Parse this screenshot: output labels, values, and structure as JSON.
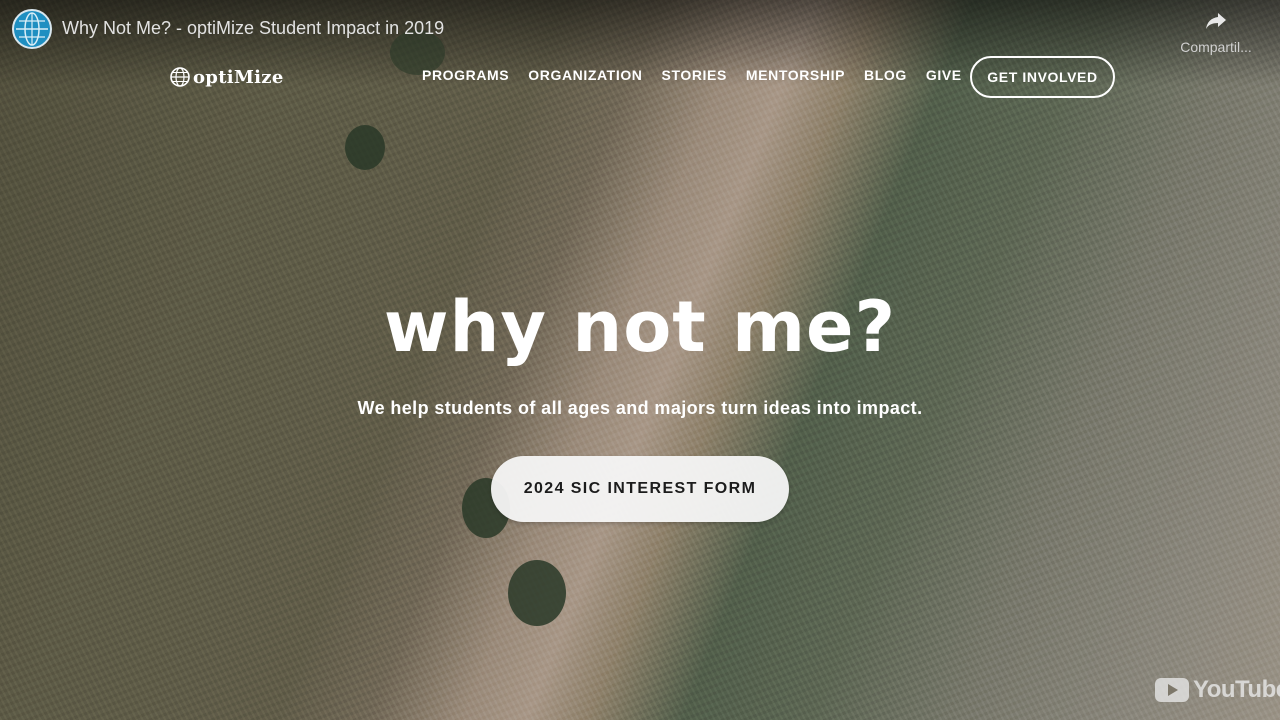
{
  "video": {
    "title": "Why Not Me? - optiMize Student Impact in 2019",
    "share_label": "Compartil..."
  },
  "site": {
    "logo_text": "optiMize",
    "nav": [
      {
        "label": "PROGRAMS"
      },
      {
        "label": "ORGANIZATION"
      },
      {
        "label": "STORIES"
      },
      {
        "label": "MENTORSHIP"
      },
      {
        "label": "BLOG"
      },
      {
        "label": "GIVE"
      }
    ],
    "get_involved_label": "GET INVOLVED"
  },
  "hero": {
    "title": "why not me?",
    "subtitle": "We help students of all ages and majors turn ideas into impact.",
    "cta_label": "2024 SIC INTEREST FORM"
  },
  "youtube": {
    "logo_text": "YouTube"
  },
  "icons": {
    "channel": "globe-avatar-icon",
    "share": "share-arrow-icon",
    "logo": "globe-icon",
    "youtube": "youtube-play-icon"
  },
  "colors": {
    "text": "#ffffff",
    "cta_bg": "#f5f5f5",
    "cta_text": "#1c1c1c",
    "avatar_blue": "#1f8fc1"
  }
}
